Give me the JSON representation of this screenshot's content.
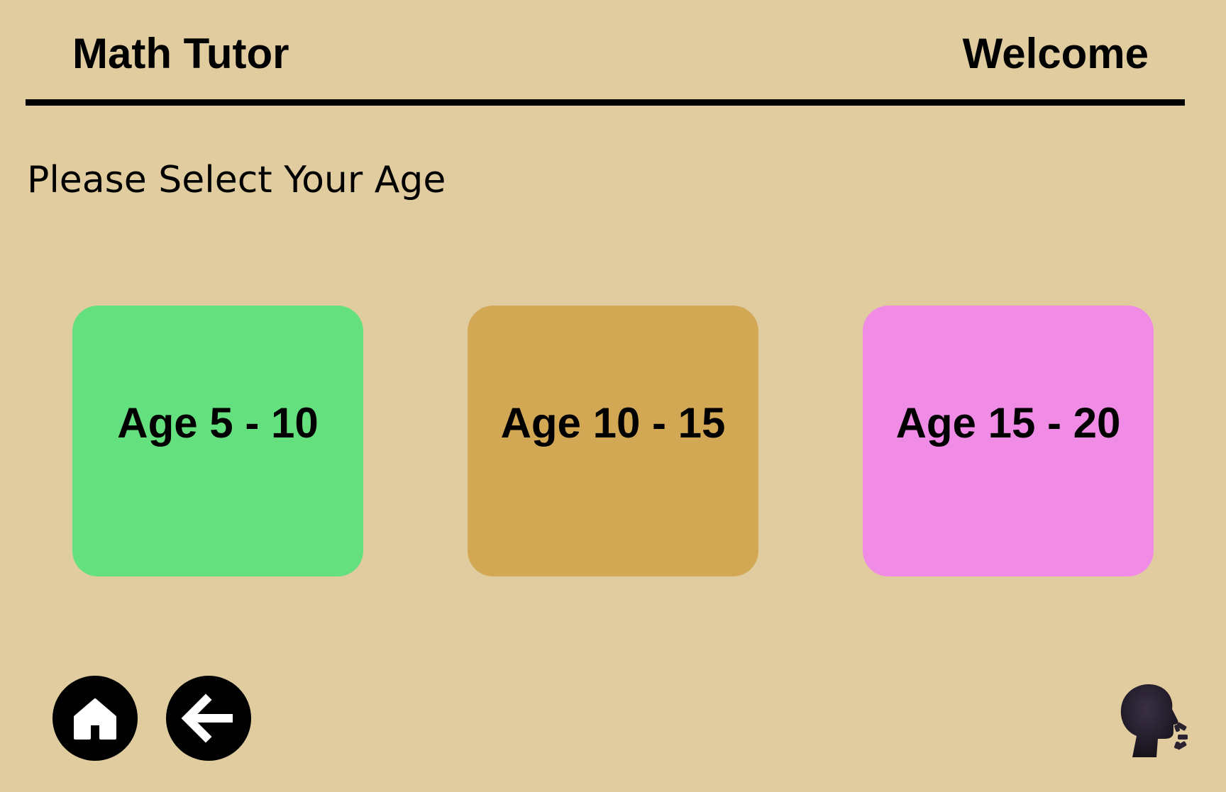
{
  "header": {
    "app_title": "Math Tutor",
    "welcome": "Welcome"
  },
  "main": {
    "prompt": "Please Select Your Age",
    "age_options": [
      {
        "label": "Age 5 - 10",
        "color": "#65e07f"
      },
      {
        "label": "Age 10 - 15",
        "color": "#d3a855"
      },
      {
        "label": "Age 15 - 20",
        "color": "#f18ce6"
      }
    ]
  },
  "footer": {
    "home_icon": "home-icon",
    "back_icon": "arrow-left-icon",
    "speak_icon": "speaking-head-icon"
  },
  "colors": {
    "background": "#e1cca0",
    "text": "#000000"
  }
}
